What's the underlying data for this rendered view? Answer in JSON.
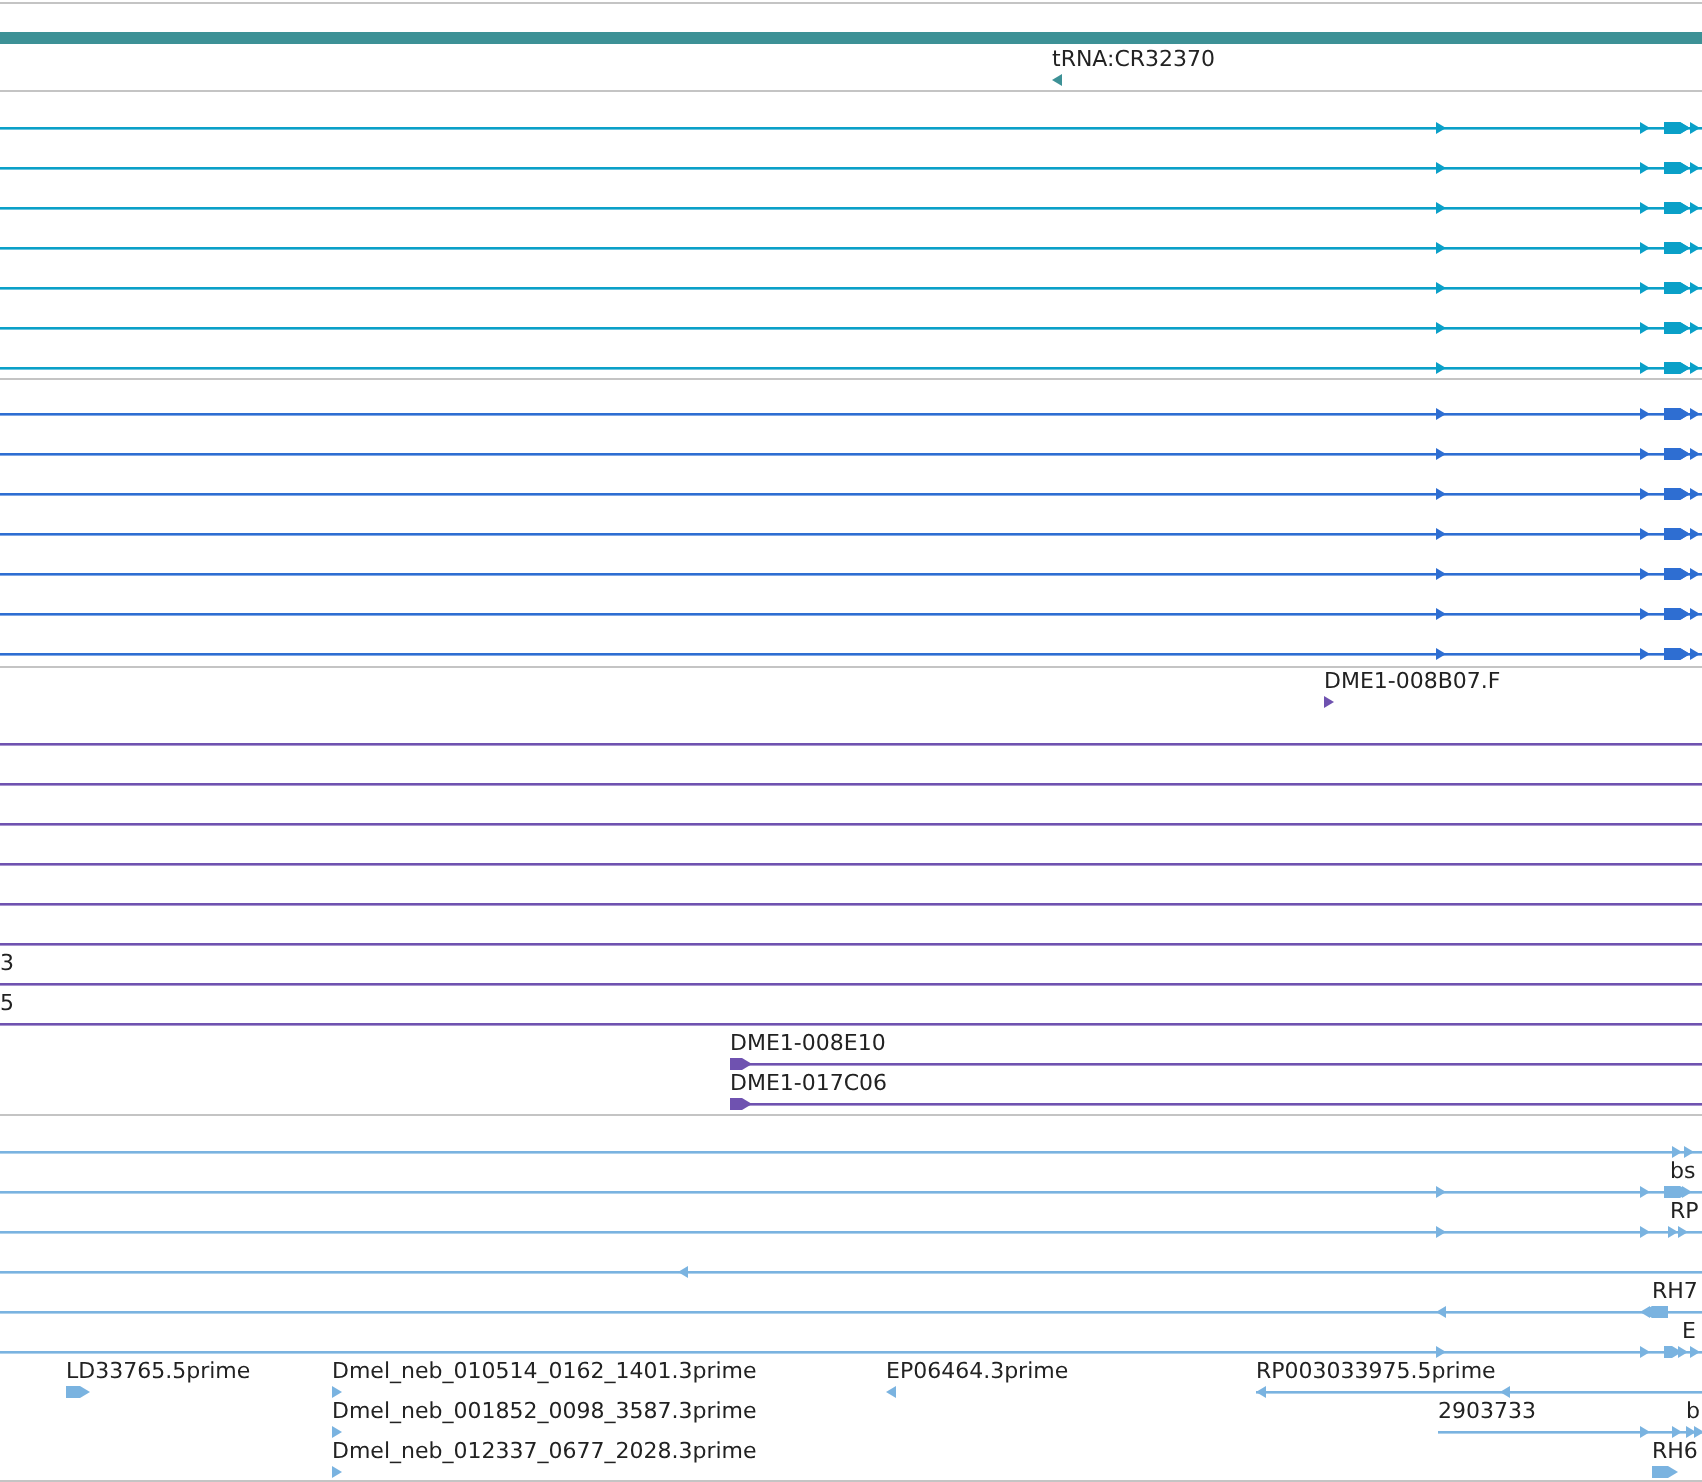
{
  "tracks": [
    {
      "color": "#3d9196",
      "features": [
        {
          "label": "tRNA:CR32370",
          "reverse": true
        }
      ]
    },
    {
      "color": "#0aa0c8",
      "features": [
        {
          "reverse": false
        },
        {
          "reverse": false
        },
        {
          "reverse": false
        },
        {
          "reverse": false
        },
        {
          "reverse": false
        },
        {
          "reverse": false
        },
        {
          "reverse": false
        }
      ]
    },
    {
      "color": "#2e6ed2",
      "features": [
        {
          "reverse": false
        },
        {
          "reverse": false
        },
        {
          "reverse": false
        },
        {
          "reverse": false
        },
        {
          "reverse": false
        },
        {
          "reverse": false
        },
        {
          "reverse": false
        }
      ]
    },
    {
      "color": "#6f52b0",
      "features": [
        {
          "label": "DME1-008B07.F",
          "reverse": false
        },
        {
          "reverse": false
        },
        {
          "reverse": false
        },
        {
          "reverse": false
        },
        {
          "reverse": false
        },
        {
          "reverse": false
        },
        {
          "reverse": false
        },
        {
          "label": "3",
          "reverse": false
        },
        {
          "label": "5",
          "reverse": false
        },
        {
          "label": "DME1-008E10",
          "reverse": false
        },
        {
          "label": "DME1-017C06",
          "reverse": false
        }
      ]
    },
    {
      "color": "#7ab3e0",
      "features": [
        {
          "reverse": false
        },
        {
          "label": "bs",
          "reverse": false
        },
        {
          "label": "RP",
          "reverse": false
        },
        {
          "reverse": true
        },
        {
          "label": "RH7",
          "reverse": true
        },
        {
          "label": "E",
          "reverse": false
        },
        {
          "label": "LD33765.5prime",
          "reverse": false
        },
        {
          "label": "Dmel_neb_010514_0162_1401.3prime",
          "reverse": false
        },
        {
          "label": "EP06464.3prime",
          "reverse": true
        },
        {
          "label": "RP003033975.5prime",
          "reverse": true
        },
        {
          "label": "Dmel_neb_001852_0098_3587.3prime",
          "reverse": false
        },
        {
          "label": "2903733",
          "reverse": false
        },
        {
          "label": "b",
          "reverse": false
        },
        {
          "label": "Dmel_neb_012337_0677_2028.3prime",
          "reverse": false
        },
        {
          "label": "RH6",
          "reverse": false
        }
      ]
    }
  ]
}
